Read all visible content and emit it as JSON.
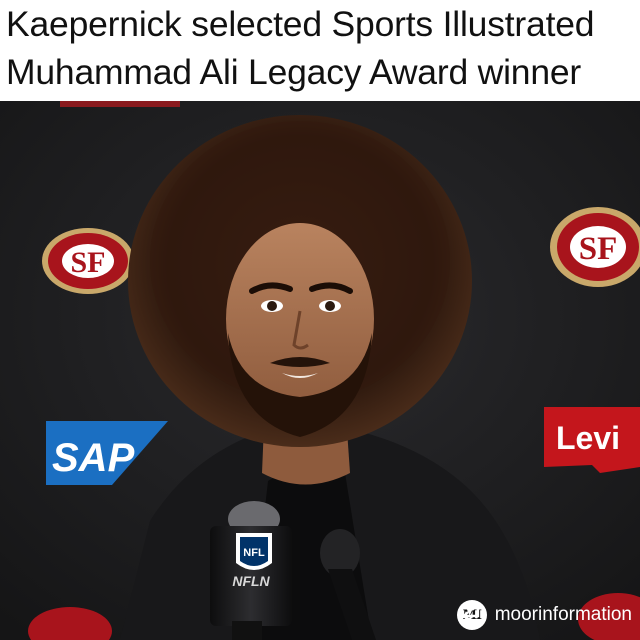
{
  "headline": {
    "line1": "Kaepernick selected Sports Illustrated",
    "line2": "Muhammad Ali Legacy Award winner"
  },
  "backdrop": {
    "logos": {
      "niners": "SF",
      "sap": "SAP",
      "levis": "Levi",
      "nfl": "NFL",
      "nfln": "NFLN"
    }
  },
  "attribution": {
    "icon": "repost-icon",
    "badge": "MI",
    "handle": "moorinformation"
  },
  "colors": {
    "niners_red": "#a8141c",
    "niners_gold": "#c9a86a",
    "sap_blue": "#1b6fc2",
    "levis_red": "#c4161c",
    "backdrop": "#1d1d1f"
  }
}
